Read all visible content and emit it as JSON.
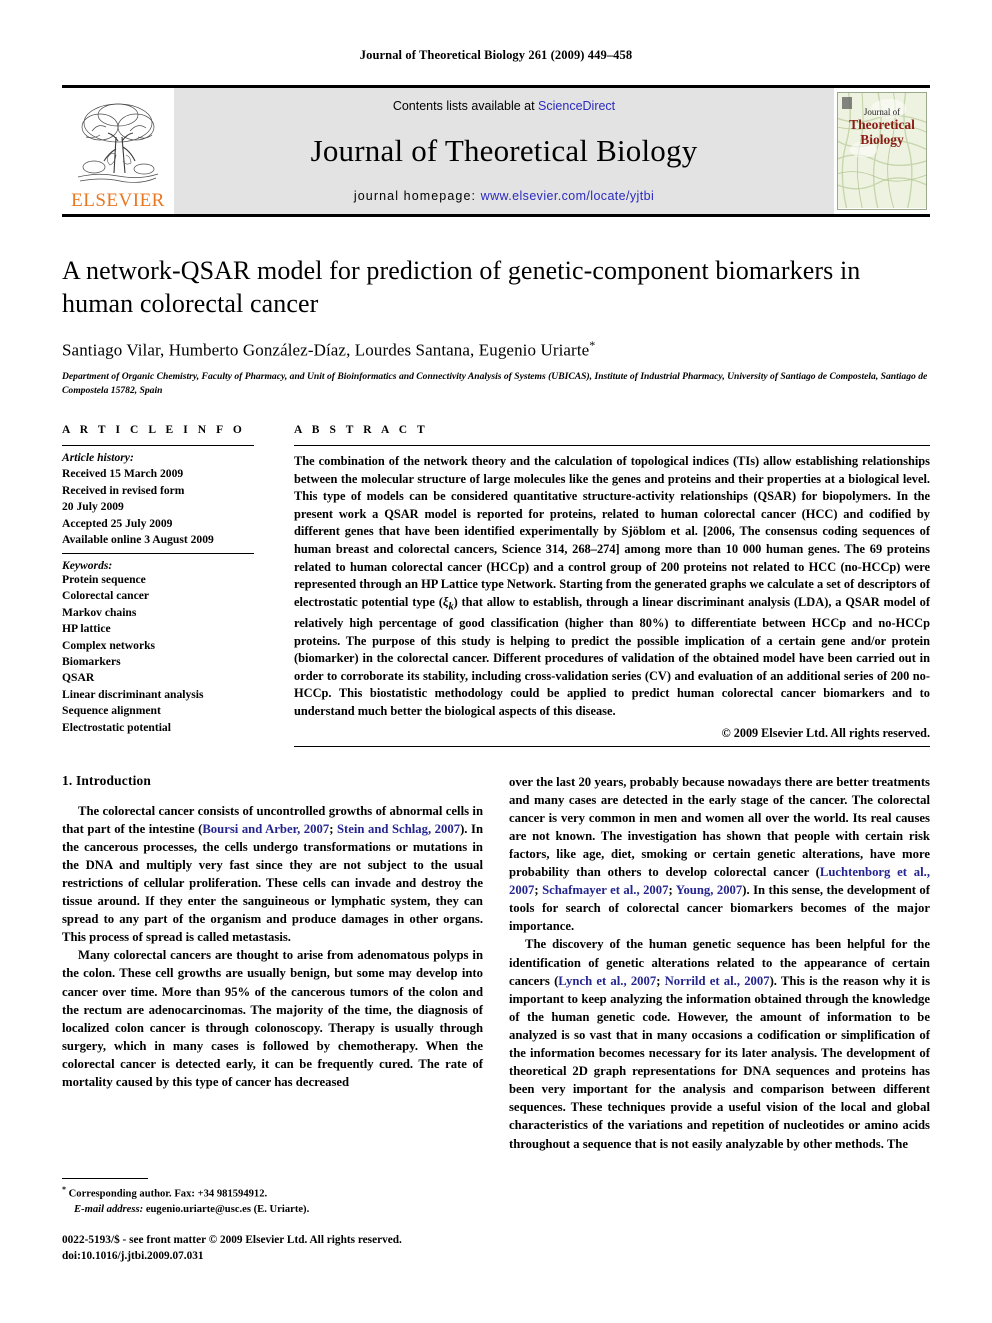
{
  "running_head": "Journal of Theoretical Biology 261 (2009) 449–458",
  "masthead": {
    "contents_prefix": "Contents lists available at ",
    "contents_link": "ScienceDirect",
    "journal_name": "Journal of Theoretical Biology",
    "homepage_prefix": "journal homepage: ",
    "homepage_url": "www.elsevier.com/locate/yjtbi",
    "publisher_wordmark": "ELSEVIER",
    "cover": {
      "line1": "Journal of",
      "line2": "Theoretical",
      "line3": "Biology"
    },
    "colors": {
      "link": "#2b2bbf",
      "elsevier_orange": "#e87722",
      "banner_gray": "#e3e3e3",
      "cover_title_red": "#8c1b16"
    }
  },
  "article": {
    "title": "A network-QSAR model for prediction of genetic-component biomarkers in human colorectal cancer",
    "authors": "Santiago Vilar, Humberto González-Díaz, Lourdes Santana, Eugenio Uriarte",
    "corresponding_marker": "*",
    "affiliation": "Department of Organic Chemistry, Faculty of Pharmacy, and Unit of Bioinformatics and Connectivity Analysis of Systems (UBICAS), Institute of Industrial Pharmacy, University of Santiago de Compostela, Santiago de Compostela 15782, Spain"
  },
  "article_info": {
    "heading": "A R T I C L E  I N F O",
    "history_label": "Article history:",
    "history": [
      "Received 15 March 2009",
      "Received in revised form",
      "20 July 2009",
      "Accepted 25 July 2009",
      "Available online 3 August 2009"
    ],
    "keywords_label": "Keywords:",
    "keywords": [
      "Protein sequence",
      "Colorectal cancer",
      "Markov chains",
      "HP lattice",
      "Complex networks",
      "Biomarkers",
      "QSAR",
      "Linear discriminant analysis",
      "Sequence alignment",
      "Electrostatic potential"
    ]
  },
  "abstract": {
    "heading": "A B S T R A C T",
    "text": "The combination of the network theory and the calculation of topological indices (TIs) allow establishing relationships between the molecular structure of large molecules like the genes and proteins and their properties at a biological level. This type of models can be considered quantitative structure-activity relationships (QSAR) for biopolymers. In the present work a QSAR model is reported for proteins, related to human colorectal cancer (HCC) and codified by different genes that have been identified experimentally by Sjöblom et al. [2006, The consensus coding sequences of human breast and colorectal cancers, Science 314, 268–274] among more than 10 000 human genes. The 69 proteins related to human colorectal cancer (HCCp) and a control group of 200 proteins not related to HCC (no-HCCp) were represented through an HP Lattice type Network. Starting from the generated graphs we calculate a set of descriptors of electrostatic potential type (ξk) that allow to establish, through a linear discriminant analysis (LDA), a QSAR model of relatively high percentage of good classification (higher than 80%) to differentiate between HCCp and no-HCCp proteins. The purpose of this study is helping to predict the possible implication of a certain gene and/or protein (biomarker) in the colorectal cancer. Different procedures of validation of the obtained model have been carried out in order to corroborate its stability, including cross-validation series (CV) and evaluation of an additional series of 200 no-HCCp. This biostatistic methodology could be applied to predict human colorectal cancer biomarkers and to understand much better the biological aspects of this disease.",
    "copyright": "© 2009 Elsevier Ltd. All rights reserved."
  },
  "body": {
    "section_heading": "1. Introduction",
    "left_paragraphs": [
      {
        "segments": [
          {
            "t": "The colorectal cancer consists of uncontrolled growths of abnormal cells in that part of the intestine (",
            "ref": false
          },
          {
            "t": "Boursi and Arber, 2007",
            "ref": true
          },
          {
            "t": "; ",
            "ref": false
          },
          {
            "t": "Stein and Schlag, 2007",
            "ref": true
          },
          {
            "t": "). In the cancerous processes, the cells undergo transformations or mutations in the DNA and multiply very fast since they are not subject to the usual restrictions of cellular proliferation. These cells can invade and destroy the tissue around. If they enter the sanguineous or lymphatic system, they can spread to any part of the organism and produce damages in other organs. This process of spread is called metastasis.",
            "ref": false
          }
        ]
      },
      {
        "segments": [
          {
            "t": "Many colorectal cancers are thought to arise from adenomatous polyps in the colon. These cell growths are usually benign, but some may develop into cancer over time. More than 95% of the cancerous tumors of the colon and the rectum are adenocarcinomas. The majority of the time, the diagnosis of localized colon cancer is through colonoscopy. Therapy is usually through surgery, which in many cases is followed by chemotherapy. When the colorectal cancer is detected early, it can be frequently cured. The rate of mortality caused by this type of cancer has decreased",
            "ref": false
          }
        ]
      }
    ],
    "right_paragraphs": [
      {
        "indent": false,
        "segments": [
          {
            "t": "over the last 20 years, probably because nowadays there are better treatments and many cases are detected in the early stage of the cancer. The colorectal cancer is very common in men and women all over the world. Its real causes are not known. The investigation has shown that people with certain risk factors, like age, diet, smoking or certain genetic alterations, have more probability than others to develop colorectal cancer (",
            "ref": false
          },
          {
            "t": "Luchtenborg et al., 2007",
            "ref": true
          },
          {
            "t": "; ",
            "ref": false
          },
          {
            "t": "Schafmayer et al., 2007",
            "ref": true
          },
          {
            "t": "; ",
            "ref": false
          },
          {
            "t": "Young, 2007",
            "ref": true
          },
          {
            "t": "). In this sense, the development of tools for search of colorectal cancer biomarkers becomes of the major importance.",
            "ref": false
          }
        ]
      },
      {
        "indent": true,
        "segments": [
          {
            "t": "The discovery of the human genetic sequence has been helpful for the identification of genetic alterations related to the appearance of certain cancers (",
            "ref": false
          },
          {
            "t": "Lynch et al., 2007",
            "ref": true
          },
          {
            "t": "; ",
            "ref": false
          },
          {
            "t": "Norrild et al., 2007",
            "ref": true
          },
          {
            "t": "). This is the reason why it is important to keep analyzing the information obtained through the knowledge of the human genetic code. However, the amount of information to be analyzed is so vast that in many occasions a codification or simplification of the information becomes necessary for its later analysis. The development of theoretical 2D graph representations for DNA sequences and proteins has been very important for the analysis and comparison between different sequences. These techniques provide a useful vision of the local and global characteristics of the variations and repetition of nucleotides or amino acids throughout a sequence that is not easily analyzable by other methods. The",
            "ref": false
          }
        ]
      }
    ]
  },
  "footnotes": {
    "corresponding": "Corresponding author. Fax: +34 981594912.",
    "email_label": "E-mail address:",
    "email": "eugenio.uriarte@usc.es (E. Uriarte).",
    "imprint_line1": "0022-5193/$ - see front matter © 2009 Elsevier Ltd. All rights reserved.",
    "imprint_line2": "doi:10.1016/j.jtbi.2009.07.031"
  }
}
